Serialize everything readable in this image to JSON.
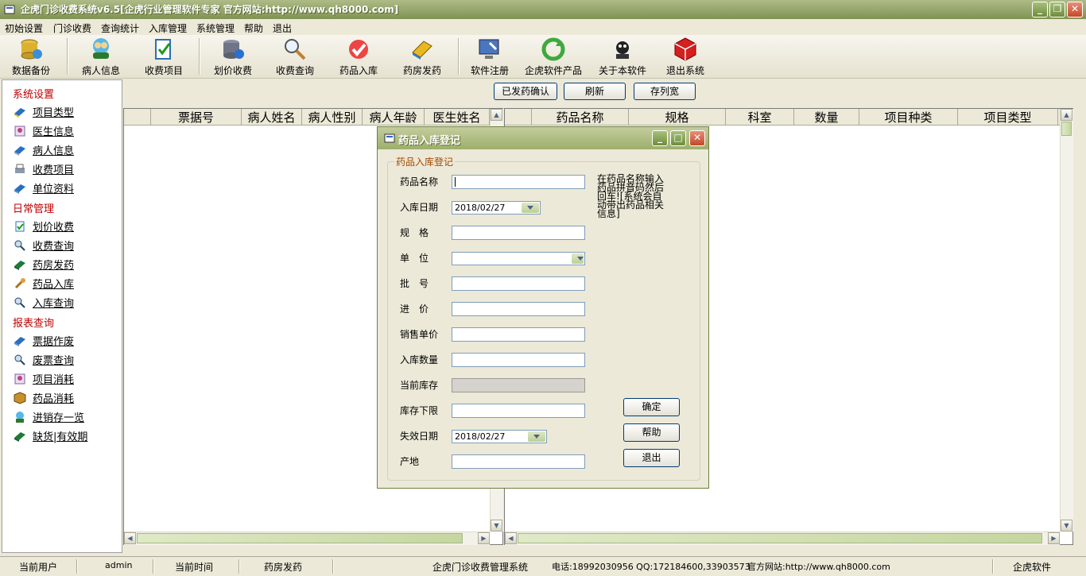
{
  "window": {
    "title": "企虎门诊收费系统v6.5[企虎行业管理软件专家 官方网站:http://www.qh8000.com]"
  },
  "menu": [
    "初始设置",
    "门诊收费",
    "查询统计",
    "入库管理",
    "系统管理",
    "帮助",
    "退出"
  ],
  "toolbar": [
    "数据备份",
    "病人信息",
    "收费项目",
    "划价收费",
    "收费查询",
    "药品入库",
    "药房发药",
    "软件注册",
    "企虎软件产品",
    "关于本软件",
    "退出系统"
  ],
  "sidebar": {
    "sections": [
      {
        "title": "系统设置",
        "items": [
          "项目类型",
          "医生信息",
          "病人信息",
          "收费项目",
          "单位资料"
        ]
      },
      {
        "title": "日常管理",
        "items": [
          "划价收费",
          "收费查询",
          "药房发药",
          "药品入库",
          "入库查询"
        ]
      },
      {
        "title": "报表查询",
        "items": [
          "票据作废",
          "废票查询",
          "项目消耗",
          "药品消耗",
          "进销存一览",
          "缺货|有效期"
        ]
      }
    ]
  },
  "actions": [
    "已发药确认",
    "刷新",
    "存列宽"
  ],
  "left_table": {
    "columns": [
      "",
      "票据号",
      "病人姓名",
      "病人性别",
      "病人年龄",
      "医生姓名"
    ]
  },
  "right_table": {
    "columns": [
      "",
      "药品名称",
      "规格",
      "科室",
      "数量",
      "项目种类",
      "项目类型"
    ]
  },
  "dialog": {
    "title": "药品入库登记",
    "group_title": "药品入库登记",
    "fields": {
      "name": "药品名称",
      "date": "入库日期",
      "spec": "规　格",
      "unit": "单　位",
      "batch": "批　号",
      "price": "进　价",
      "sale": "销售单价",
      "qty": "入库数量",
      "stock": "当前库存",
      "min": "库存下限",
      "expire": "失效日期",
      "origin": "产地"
    },
    "date_value": "2018/02/27",
    "expire_value": "2018/02/27",
    "hint": "在药品名称输入药品拼音码然后回车![系统会自动带出药品相关信息]",
    "buttons": {
      "ok": "确定",
      "help": "帮助",
      "exit": "退出"
    }
  },
  "status": {
    "user_label": "当前用户",
    "user": "admin",
    "time_label": "当前时间",
    "module": "药房发药",
    "system": "企虎门诊收费管理系统",
    "phone": "电话:18992030956 QQ:172184600,33903573",
    "site": "官方网站:http://www.qh8000.com",
    "brand": "企虎软件"
  }
}
